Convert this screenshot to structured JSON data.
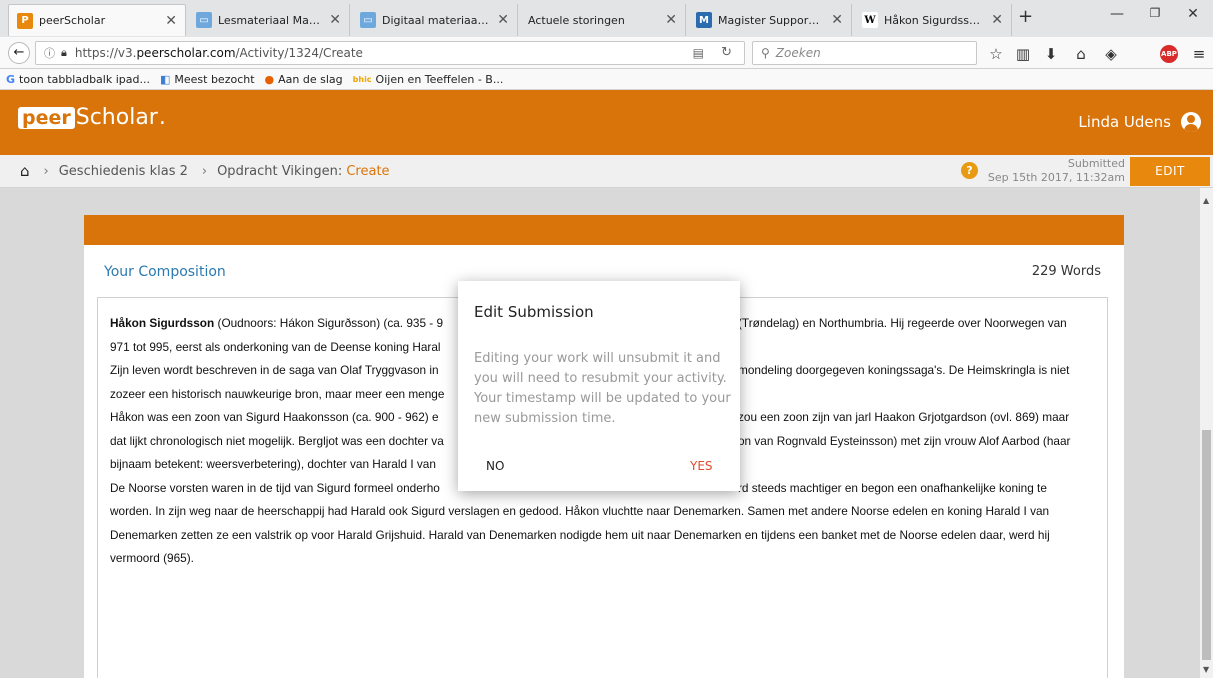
{
  "browser": {
    "tabs": [
      {
        "label": "peerScholar",
        "icon": "peerscholar-icon",
        "color": "#e8880d",
        "glyph": "P"
      },
      {
        "label": "Lesmateriaal Maken",
        "icon": "document-icon",
        "color": "#6fa8dc",
        "glyph": "L"
      },
      {
        "label": "Digitaal materiaal: var",
        "icon": "document-icon",
        "color": "#6fa8dc",
        "glyph": "D"
      },
      {
        "label": "Actuele storingen",
        "icon": "blank-icon",
        "color": "#ffffff",
        "glyph": ""
      },
      {
        "label": "Magister Support > S",
        "icon": "magister-icon",
        "color": "#2b6cb0",
        "glyph": "M"
      },
      {
        "label": "Håkon Sigurdsson - V",
        "icon": "wikipedia-icon",
        "color": "#ffffff",
        "glyph": "W"
      }
    ],
    "url_prefix": "https://v3.",
    "url_domain": "peerscholar.com",
    "url_path": "/Activity/1324/Create",
    "search_placeholder": "Zoeken",
    "bookmarks": [
      {
        "label": "toon tabbladbalk ipad...",
        "icon": "google-icon"
      },
      {
        "label": "Meest bezocht",
        "icon": "search-favicon"
      },
      {
        "label": "Aan de slag",
        "icon": "firefox-icon"
      },
      {
        "label": "Oijen en Teeffelen - B...",
        "icon": "bhic-icon"
      }
    ],
    "bookmark_glyph_bhic": "bhic"
  },
  "app": {
    "logo_peer": "peer",
    "logo_scholar": "Scholar",
    "logo_dot": ".",
    "user_name": "Linda Udens",
    "brand_color": "#d9740a"
  },
  "breadcrumb": {
    "course": "Geschiedenis klas 2",
    "assignment": "Opdracht Vikingen:",
    "current": "Create",
    "help": "?",
    "status_label": "Submitted",
    "status_time": "Sep 15th 2017, 11:32am",
    "edit_label": "EDIT"
  },
  "composition": {
    "title": "Your Composition",
    "word_count": "229 Words",
    "lines": [
      {
        "bold": "Håkon Sigurdsson",
        "text": " (Oudnoors: Hákon Sigurðsson) (ca. 935 - 9",
        "tail": "(Trøndelag) en Northumbria. Hij regeerde over Noorwegen van"
      },
      {
        "bold": "",
        "text": "971 tot 995, eerst als onderkoning van de Deense koning Haral",
        "tail": ""
      },
      {
        "bold": "",
        "text": "Zijn leven wordt beschreven in de saga van Olaf Tryggvason in",
        "tail": "mondeling doorgegeven koningssaga's. De Heimskringla is niet"
      },
      {
        "bold": "",
        "text": "zozeer een historisch nauwkeurige bron, maar meer een menge",
        "tail": ""
      },
      {
        "bold": "",
        "text": "Håkon was een zoon van Sigurd Haakonsson (ca. 900 - 962) e",
        "tail": "zou een zoon zijn van jarl Haakon Grjotgardson (ovl. 869) maar"
      },
      {
        "bold": "",
        "text": "dat lijkt chronologisch niet mogelijk. Bergljot was een dochter va",
        "tail": "on van Rognvald Eysteinsson) met zijn vrouw Alof Aarbod (haar"
      },
      {
        "bold": "",
        "text": "bijnaam betekent: weersverbetering), dochter van Harald I van",
        "tail": ""
      },
      {
        "bold": "",
        "text": "De Noorse vorsten waren in de tijd van Sigurd formeel onderho",
        "tail": "rd steeds machtiger en begon een onafhankelijke koning te"
      },
      {
        "bold": "",
        "text": "worden. In zijn weg naar de heerschappij had Harald ook Sigurd verslagen en gedood. Håkon vluchtte naar Denemarken. Samen met andere Noorse edelen en koning Harald I van",
        "tail": ""
      },
      {
        "bold": "",
        "text": "Denemarken zetten ze een valstrik op voor Harald Grijshuid. Harald van Denemarken nodigde hem uit naar Denemarken en tijdens een banket met de Noorse edelen daar, werd hij",
        "tail": ""
      },
      {
        "bold": "",
        "text": "vermoord (965).",
        "tail": ""
      }
    ]
  },
  "dialog": {
    "title": "Edit Submission",
    "body": "Editing your work will unsubmit it and you will need to resubmit your activity. Your timestamp will be updated to your new submission time.",
    "no_label": "NO",
    "yes_label": "YES",
    "yes_color": "#e04b2c"
  }
}
